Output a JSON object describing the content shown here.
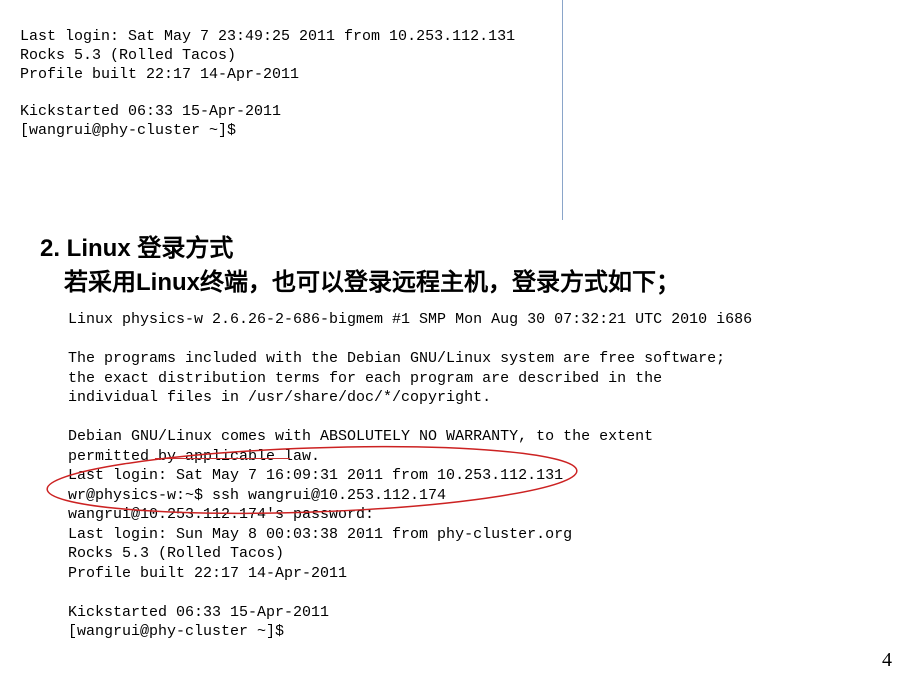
{
  "terminal_top": {
    "line1": "Last login: Sat May  7 23:49:25 2011 from 10.253.112.131",
    "line2": "Rocks 5.3 (Rolled Tacos)",
    "line3": "Profile built 22:17 14-Apr-2011",
    "line4": "",
    "line5": "Kickstarted 06:33 15-Apr-2011",
    "line6": "[wangrui@phy-cluster ~]$"
  },
  "heading": "2. Linux 登录方式",
  "subheading": "若采用Linux终端，也可以登录远程主机，登录方式如下；",
  "terminal_bottom": {
    "line1": "Linux physics-w 2.6.26-2-686-bigmem #1 SMP Mon Aug 30 07:32:21 UTC 2010 i686",
    "line2": "",
    "line3": "The programs included with the Debian GNU/Linux system are free software;",
    "line4": "the exact distribution terms for each program are described in the",
    "line5": "individual files in /usr/share/doc/*/copyright.",
    "line6": "",
    "line7": "Debian GNU/Linux comes with ABSOLUTELY NO WARRANTY, to the extent",
    "line8": "permitted by applicable law.",
    "line9": "Last login: Sat May  7 16:09:31 2011 from 10.253.112.131",
    "line10": "wr@physics-w:~$ ssh wangrui@10.253.112.174",
    "line11": "wangrui@10.253.112.174's password:",
    "line12": "Last login: Sun May  8 00:03:38 2011 from phy-cluster.org",
    "line13": "Rocks 5.3 (Rolled Tacos)",
    "line14": "Profile built 22:17 14-Apr-2011",
    "line15": "",
    "line16": "Kickstarted 06:33 15-Apr-2011",
    "line17": "[wangrui@phy-cluster ~]$"
  },
  "page_number": "4"
}
